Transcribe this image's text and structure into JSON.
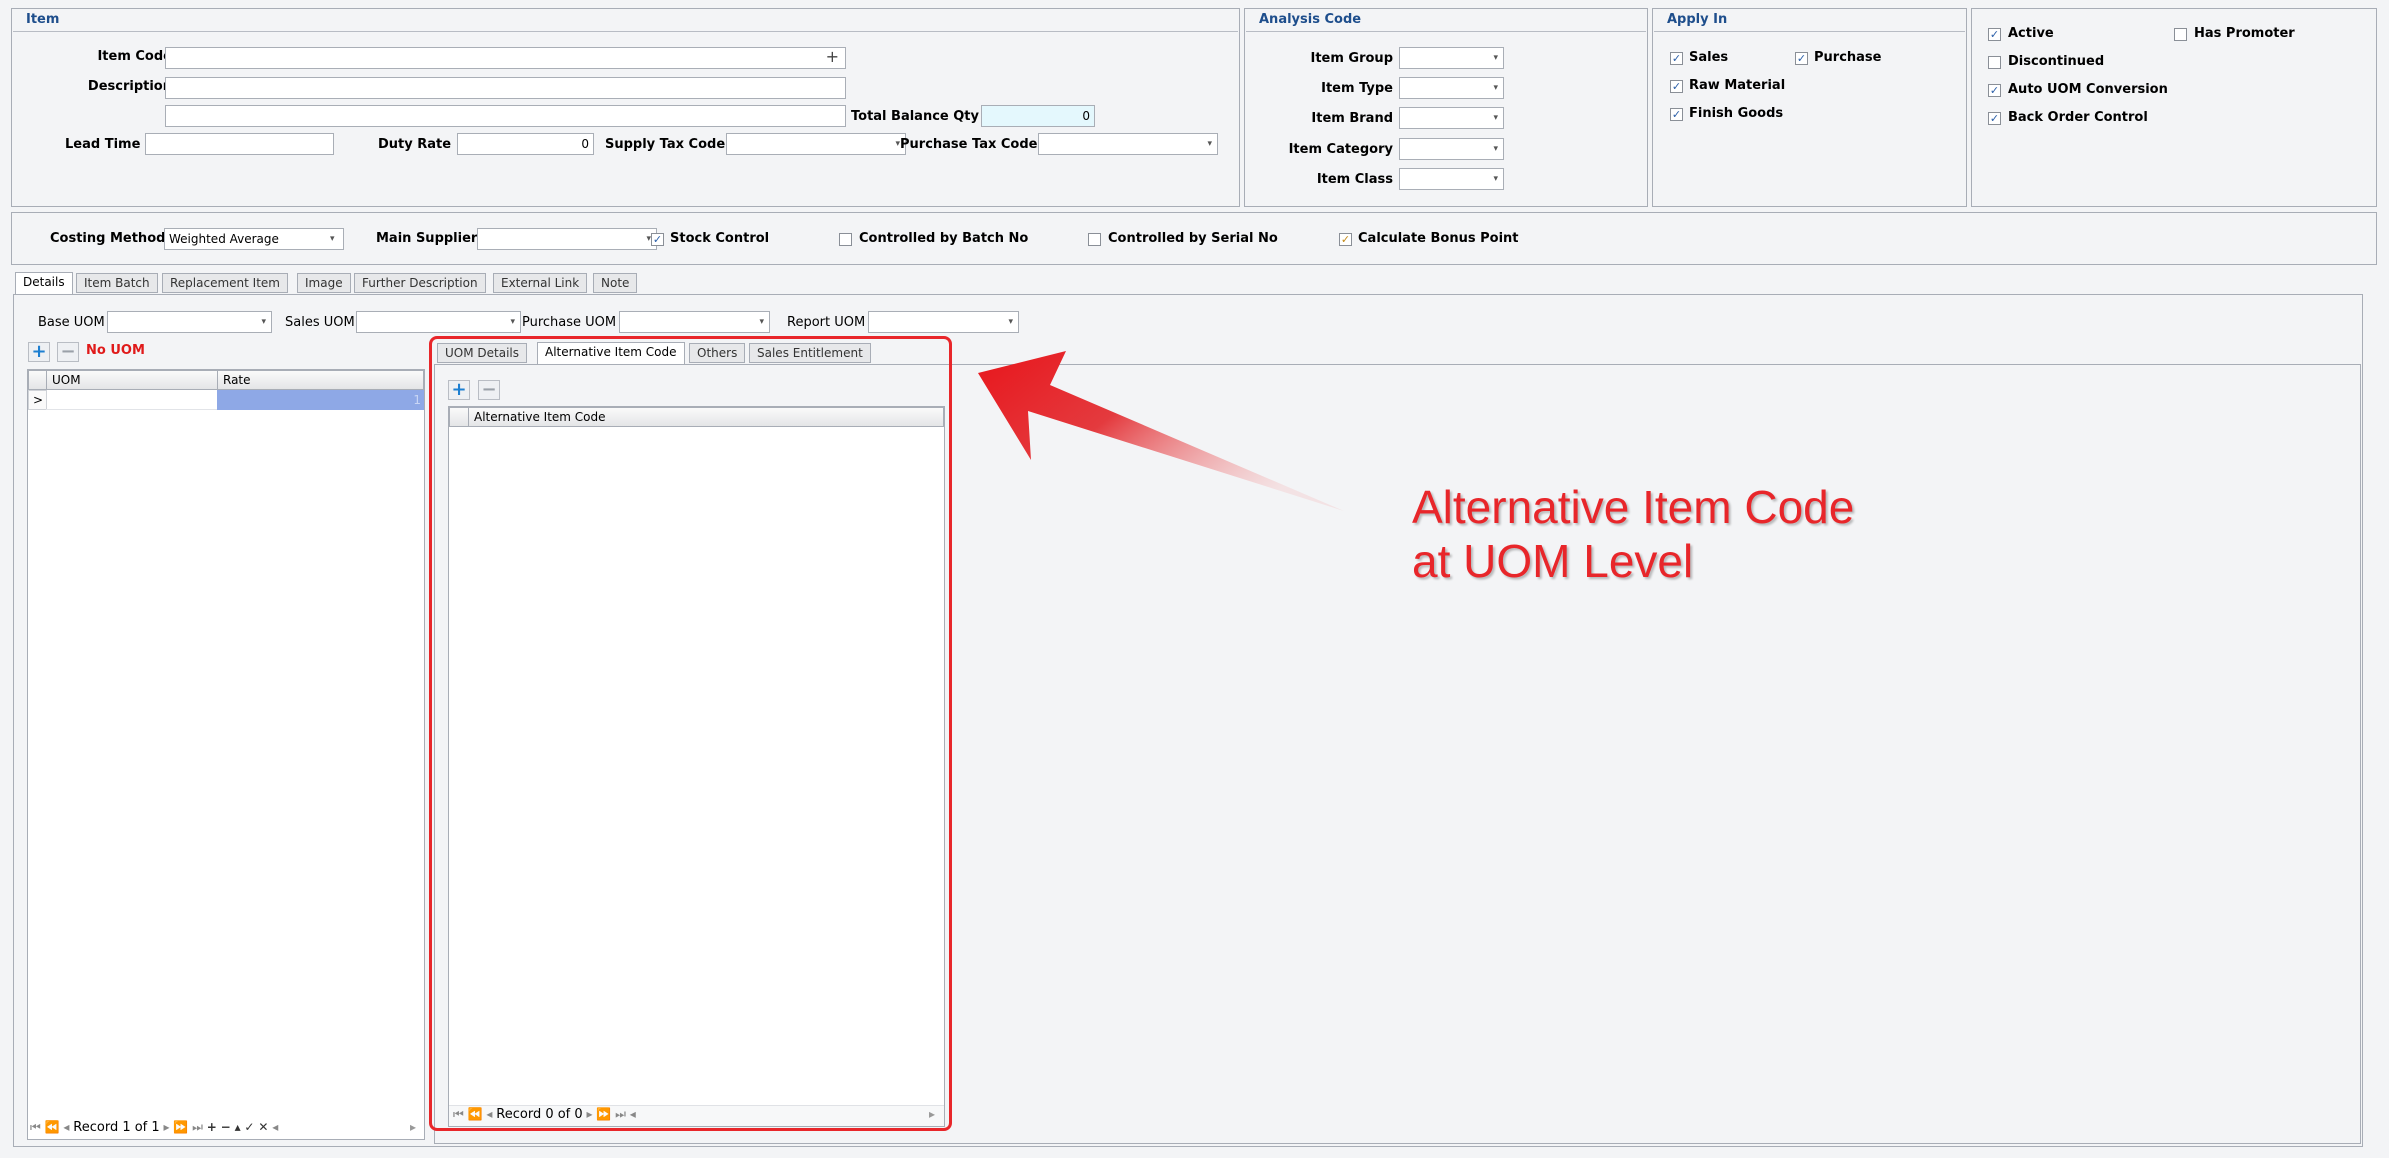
{
  "item": {
    "title": "Item",
    "item_code_label": "Item Code",
    "description_label": "Description",
    "total_balance_label": "Total Balance Qty",
    "total_balance_value": "0",
    "lead_time_label": "Lead Time",
    "duty_rate_label": "Duty Rate",
    "duty_rate_value": "0",
    "supply_tax_label": "Supply Tax Code",
    "purchase_tax_label": "Purchase Tax Code"
  },
  "analysis": {
    "title": "Analysis Code",
    "fields": [
      "Item Group",
      "Item Type",
      "Item Brand",
      "Item Category",
      "Item Class"
    ]
  },
  "apply_in": {
    "title": "Apply In",
    "sales": "Sales",
    "purchase": "Purchase",
    "raw_material": "Raw Material",
    "finish_goods": "Finish Goods"
  },
  "flags": {
    "active": "Active",
    "has_promoter": "Has Promoter",
    "discontinued": "Discontinued",
    "auto_uom": "Auto UOM Conversion",
    "back_order": "Back Order Control"
  },
  "costing": {
    "method_label": "Costing Method",
    "method_value": "Weighted Average",
    "supplier_label": "Main Supplier",
    "stock_control": "Stock Control",
    "batch_no": "Controlled by Batch No",
    "serial_no": "Controlled by Serial No",
    "bonus_point": "Calculate Bonus Point"
  },
  "tabs": [
    "Details",
    "Item Batch",
    "Replacement Item",
    "Image",
    "Further Description",
    "External Link",
    "Note"
  ],
  "uom": {
    "base_label": "Base UOM",
    "sales_label": "Sales UOM",
    "purchase_label": "Purchase UOM",
    "report_label": "Report UOM",
    "no_uom": "No UOM",
    "col_uom": "UOM",
    "col_rate": "Rate",
    "row_indicator": ">",
    "row_rate": "1",
    "record": "Record 1 of 1"
  },
  "subtabs": [
    "UOM Details",
    "Alternative Item Code",
    "Others",
    "Sales Entitlement"
  ],
  "alt_grid": {
    "col": "Alternative Item Code",
    "record": "Record 0 of 0"
  },
  "annotation": {
    "line1": "Alternative Item Code",
    "line2": "at UOM Level",
    "color": "#e8262a"
  },
  "icons": {
    "add": "plus-icon",
    "remove": "minus-icon"
  }
}
